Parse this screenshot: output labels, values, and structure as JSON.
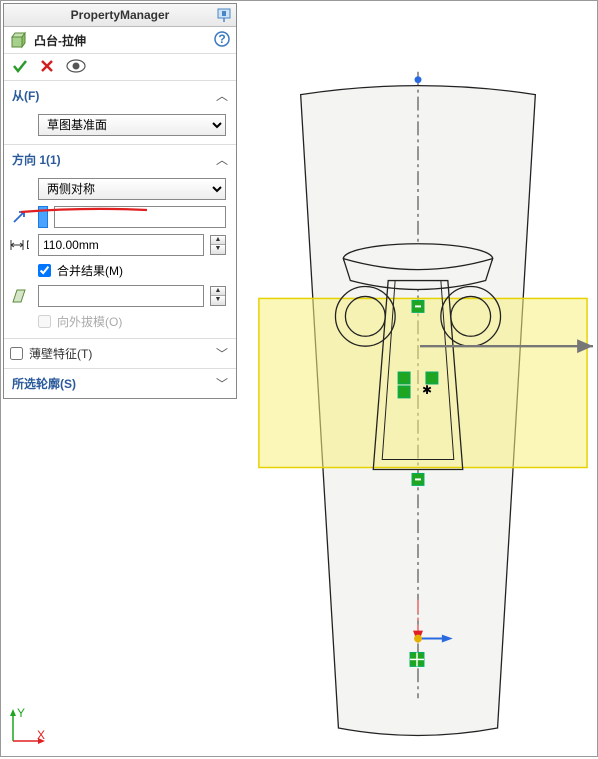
{
  "header": {
    "title": "PropertyManager"
  },
  "feature": {
    "name": "凸台-拉伸"
  },
  "sections": {
    "from": {
      "label": "从(F)",
      "select_value": "草图基准面"
    },
    "dir1": {
      "label": "方向 1(1)",
      "select_value": "两侧对称",
      "depth_value": "110.00mm",
      "merge_label": "合并结果(M)",
      "draft_label": "向外拔模(O)"
    },
    "thin": {
      "label": "薄壁特征(T)"
    },
    "contours": {
      "label": "所选轮廓(S)"
    }
  },
  "axes": {
    "x": "X",
    "y": "Y"
  }
}
